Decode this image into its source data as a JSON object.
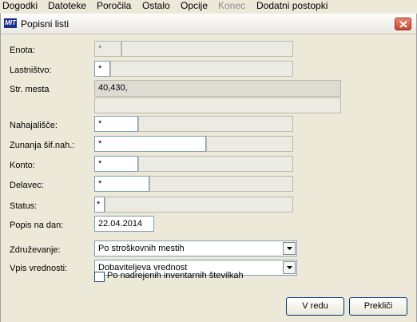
{
  "menu": {
    "items": [
      {
        "label": "Dogodki",
        "disabled": false
      },
      {
        "label": "Datoteke",
        "disabled": false
      },
      {
        "label": "Poročila",
        "disabled": false
      },
      {
        "label": "Ostalo",
        "disabled": false
      },
      {
        "label": "Opcije",
        "disabled": false
      },
      {
        "label": "Konec",
        "disabled": true
      },
      {
        "label": "Dodatni postopki",
        "disabled": false
      }
    ]
  },
  "window": {
    "icon_text": "MIT",
    "title": "Popisni listi"
  },
  "form": {
    "enota": {
      "label": "Enota:",
      "value": "*"
    },
    "lastnistvo": {
      "label": "Lastništvo:",
      "value": "*"
    },
    "str_mesta": {
      "label": "Str. mesta",
      "value": "40,430,"
    },
    "nahajalisce": {
      "label": "Nahajališče:",
      "value": "*"
    },
    "zunanja": {
      "label": "Zunanja šif.nah.:",
      "value": "*"
    },
    "konto": {
      "label": "Konto:",
      "value": "*"
    },
    "delavec": {
      "label": "Delavec:",
      "value": "*"
    },
    "status": {
      "label": "Status:",
      "value": "*"
    },
    "popis_na_dan": {
      "label": "Popis na dan:",
      "value": "22.04.2014"
    },
    "zdruzevanje": {
      "label": "Združevanje:",
      "value": "Po stroškovnih mestih"
    },
    "vpis_vrednosti": {
      "label": "Vpis vrednosti:",
      "value": "Dobaviteljeva vrednost"
    },
    "nadrejeni": {
      "label": "Po nadrejenih inventarnih številkah",
      "checked": false
    }
  },
  "buttons": {
    "ok": "V redu",
    "cancel": "Prekliči"
  },
  "colors": {
    "window_bg": "#ece9d8",
    "close_button": "#c84a30",
    "field_border": "#7f9db9"
  }
}
